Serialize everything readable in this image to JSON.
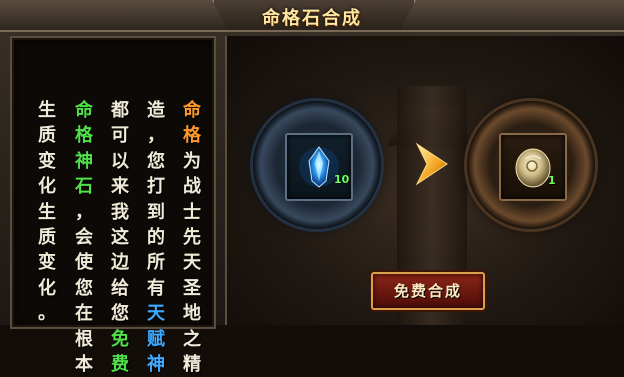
{
  "window": {
    "title": "命格石合成"
  },
  "description": {
    "columns": [
      {
        "chars": [
          "生",
          "质",
          "变",
          "化",
          "生",
          "质",
          "变",
          "化",
          "。"
        ],
        "colors": [
          "white",
          "white",
          "white",
          "white",
          "white",
          "white",
          "white",
          "white",
          "white"
        ]
      },
      {
        "chars": [
          "命",
          "格",
          "神",
          "石",
          "，",
          "会",
          "使",
          "您",
          "在",
          "根",
          "本"
        ],
        "colors": [
          "green",
          "green",
          "green",
          "green",
          "white",
          "white",
          "white",
          "white",
          "white",
          "white",
          "white"
        ]
      },
      {
        "chars": [
          "都",
          "可",
          "以",
          "来",
          "我",
          "这",
          "边",
          "给",
          "您",
          "免",
          "费"
        ],
        "colors": [
          "white",
          "white",
          "white",
          "white",
          "white",
          "white",
          "white",
          "white",
          "white",
          "green",
          "green"
        ]
      },
      {
        "chars": [
          "造",
          "，",
          "您",
          "打",
          "到",
          "的",
          "所",
          "有",
          "天",
          "赋",
          "神"
        ],
        "colors": [
          "white",
          "white",
          "white",
          "white",
          "white",
          "white",
          "white",
          "white",
          "blue",
          "blue",
          "blue"
        ]
      },
      {
        "chars": [
          "命",
          "格",
          "为",
          "战",
          "士",
          "先",
          "天",
          "圣",
          "地",
          "之",
          "精"
        ],
        "colors": [
          "orange",
          "orange",
          "white",
          "white",
          "white",
          "white",
          "white",
          "white",
          "white",
          "white",
          "white"
        ]
      }
    ]
  },
  "synthesis": {
    "source_item": {
      "icon": "blue-crystal-icon",
      "count": "10"
    },
    "result_item": {
      "icon": "fate-stone-icon",
      "count": "1"
    },
    "button_label": "免费合成"
  },
  "colors": {
    "white": "#f0ead8",
    "orange": "#ff9a2a",
    "green": "#4fe04a",
    "blue": "#3fa9ff"
  }
}
